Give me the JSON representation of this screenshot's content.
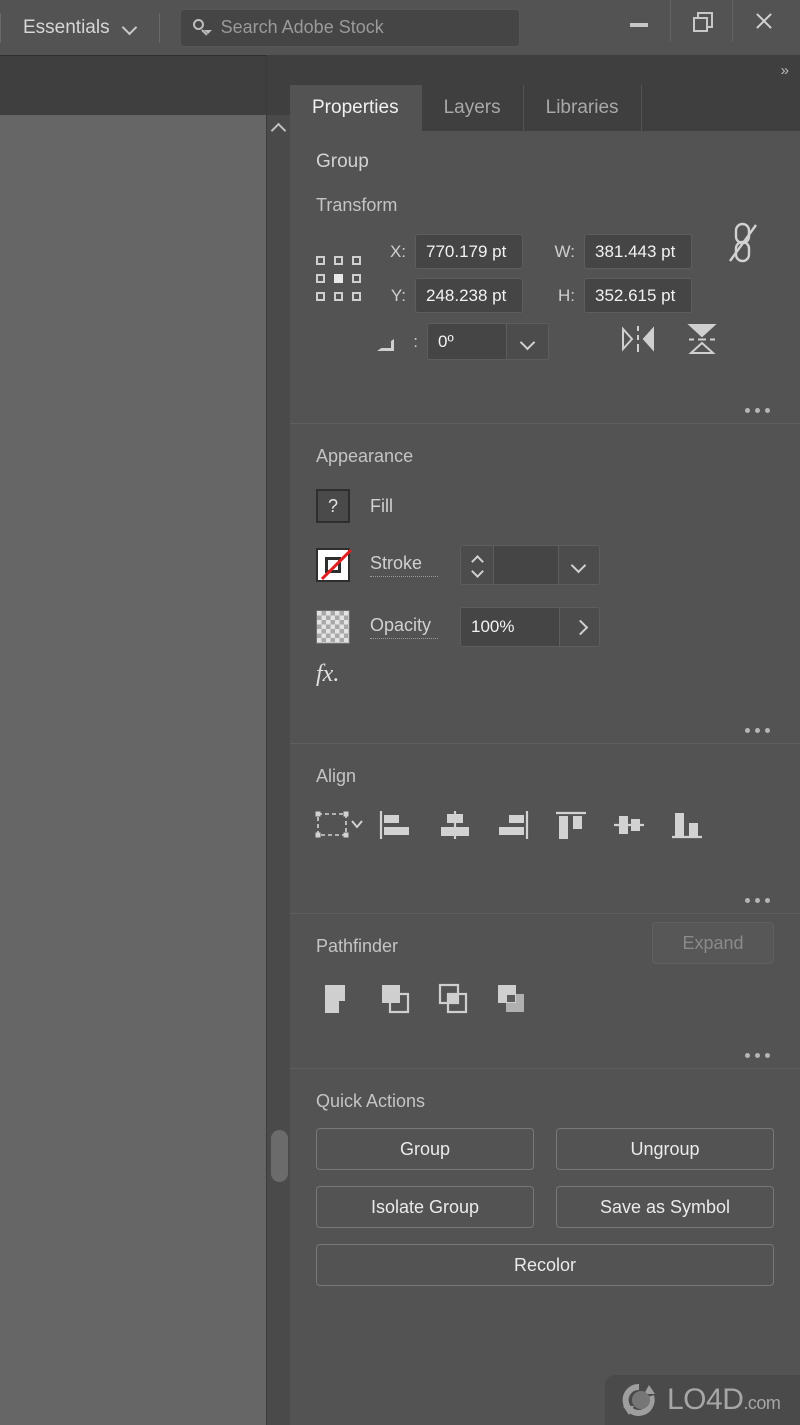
{
  "menubar": {
    "workspace_label": "Essentials",
    "workspace_chevron_icon": "chevron-down-icon",
    "search_icon": "search-adobe-stock-icon",
    "search_placeholder": "Search Adobe Stock",
    "search_value": "",
    "window_controls": {
      "minimize_icon": "minimize-icon",
      "restore_icon": "restore-icon",
      "close_icon": "close-icon"
    }
  },
  "panel": {
    "expand_icon": "double-chevron-right-icon",
    "tabs": [
      {
        "label": "Properties",
        "active": true
      },
      {
        "label": "Layers",
        "active": false
      },
      {
        "label": "Libraries",
        "active": false
      }
    ],
    "object_type": "Group",
    "sections": {
      "transform": {
        "title": "Transform",
        "reference_point_icon": "reference-point-grid-icon",
        "fields": [
          {
            "label": "X:",
            "value": "770.179 pt"
          },
          {
            "label": "Y:",
            "value": "248.238 pt"
          },
          {
            "label": "W:",
            "value": "381.443 pt"
          },
          {
            "label": "H:",
            "value": "352.615 pt"
          }
        ],
        "angle": {
          "icon": "angle-icon",
          "label": "△:",
          "value": "0º"
        },
        "angle_dropdown_icon": "chevron-down-icon",
        "link_icon": "chain-broken-icon",
        "flip_horizontal_icon": "flip-horizontal-icon",
        "flip_vertical_icon": "flip-vertical-icon",
        "more_options_icon": "more-options-icon"
      },
      "appearance": {
        "title": "Appearance",
        "fill": {
          "label": "Fill",
          "swatch_icon": "fill-unknown-swatch-icon",
          "swatch_glyph": "?"
        },
        "stroke": {
          "label": "Stroke",
          "swatch_icon": "stroke-none-swatch-icon",
          "weight_value": "",
          "stepper_icon": "stepper-updown-icon",
          "dropdown_icon": "chevron-down-icon"
        },
        "opacity": {
          "label": "Opacity",
          "swatch_icon": "transparency-checker-icon",
          "value": "100%",
          "arrow_icon": "chevron-right-icon"
        },
        "effects_icon": "fx-effects-icon",
        "effects_glyph": "fx.",
        "more_options_icon": "more-options-icon"
      },
      "align": {
        "title": "Align",
        "buttons": [
          "align-to-selection-icon",
          "align-left-edges-icon",
          "align-horizontal-centers-icon",
          "align-right-edges-icon",
          "align-top-edges-icon",
          "align-vertical-centers-icon",
          "align-bottom-edges-icon"
        ],
        "more_options_icon": "more-options-icon"
      },
      "pathfinder": {
        "title": "Pathfinder",
        "buttons": [
          "unite-icon",
          "minus-front-icon",
          "intersect-icon",
          "exclude-icon"
        ],
        "expand_label": "Expand",
        "expand_disabled": true,
        "more_options_icon": "more-options-icon"
      },
      "quick_actions": {
        "title": "Quick Actions",
        "buttons": [
          [
            "Group",
            "Ungroup"
          ],
          [
            "Isolate Group",
            "Save as Symbol"
          ],
          [
            "Recolor"
          ]
        ]
      }
    }
  },
  "canvas": {
    "scrollbar_up_icon": "scroll-up-chevron-icon",
    "scrollbar_thumb": "vertical-scrollbar-thumb"
  },
  "watermark": {
    "logo_icon": "lo4d-refresh-logo-icon",
    "name": "LO4D",
    "tld": ".com"
  },
  "colors": {
    "app_bg": "#535353",
    "bar_bg": "#3f3f3f",
    "canvas_bg": "#666666",
    "input_bg": "#454545",
    "text": "#d6d6d6",
    "stroke_none_red": "#e02020"
  }
}
